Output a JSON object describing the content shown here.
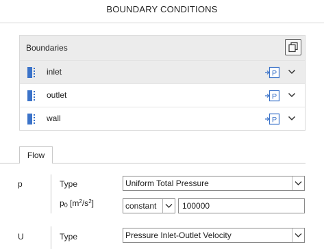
{
  "panel_title": "BOUNDARY CONDITIONS",
  "boundaries": {
    "header_label": "Boundaries",
    "copy_icon": "copy-icon",
    "items": [
      {
        "name": "inlet",
        "selected": true,
        "type_badge": "P",
        "icon": "patch-icon"
      },
      {
        "name": "outlet",
        "selected": false,
        "type_badge": "P",
        "icon": "patch-icon"
      },
      {
        "name": "wall",
        "selected": false,
        "type_badge": "P",
        "icon": "patch-icon"
      }
    ]
  },
  "tabs": [
    {
      "label": "Flow",
      "active": true
    }
  ],
  "fields": {
    "p": {
      "label": "p",
      "type_label": "Type",
      "type_value": "Uniform Total Pressure",
      "p0_symbol": "p",
      "p0_subscript": "0",
      "p0_unit_open": "[m",
      "p0_unit_sup1": "2",
      "p0_unit_mid": "/s",
      "p0_unit_sup2": "2",
      "p0_unit_close": "]",
      "p0_mode": "constant",
      "p0_value": "100000"
    },
    "U": {
      "label": "U",
      "type_label": "Type",
      "type_value": "Pressure Inlet-Outlet Velocity"
    }
  },
  "colors": {
    "accent_blue": "#3b73c9",
    "selected_row_bg": "#ececec"
  }
}
